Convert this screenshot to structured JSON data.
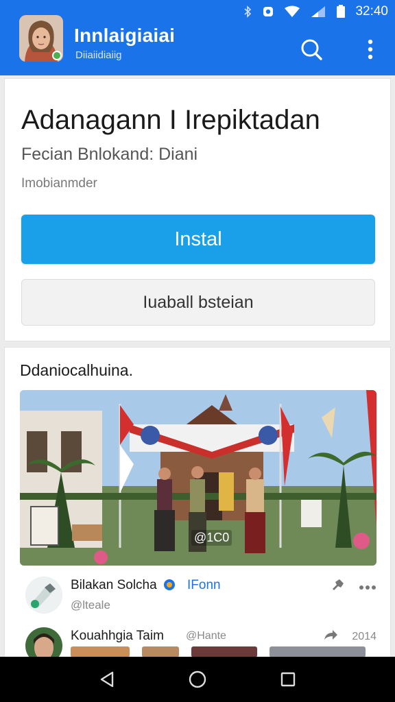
{
  "status_bar": {
    "time": "32:40",
    "icons": [
      "bluetooth-icon",
      "record-icon",
      "wifi-icon",
      "signal-icon",
      "battery-icon"
    ]
  },
  "app_bar": {
    "title": "Innlaigiaiai",
    "subtitle": "Diiaiidiaiig",
    "actions": [
      "search-icon",
      "more-vert-icon"
    ],
    "color": "#1a73e8"
  },
  "app_card": {
    "name": "Adanagann I Irepiktadan",
    "developer": "Fecian Bnlokand: Diani",
    "category": "Imobianmder",
    "install_label": "Instal",
    "secondary_label": "Iuaball bsteian",
    "install_color": "#1aa0e8"
  },
  "feed": {
    "section_title": "Ddaniocalhuina.",
    "media_label": "@1C0",
    "posts": [
      {
        "name": "Bilakan Solcha",
        "tag": "IFonn",
        "handle": "@lteale",
        "icons": [
          "pin-icon",
          "more-horiz-icon"
        ]
      },
      {
        "name": "Kouahhgia Taim",
        "handle": "@Hante",
        "count": "2014",
        "icons": [
          "share-icon"
        ]
      }
    ]
  },
  "nav_bar": {
    "buttons": [
      "back-icon",
      "home-icon",
      "recents-icon"
    ]
  }
}
